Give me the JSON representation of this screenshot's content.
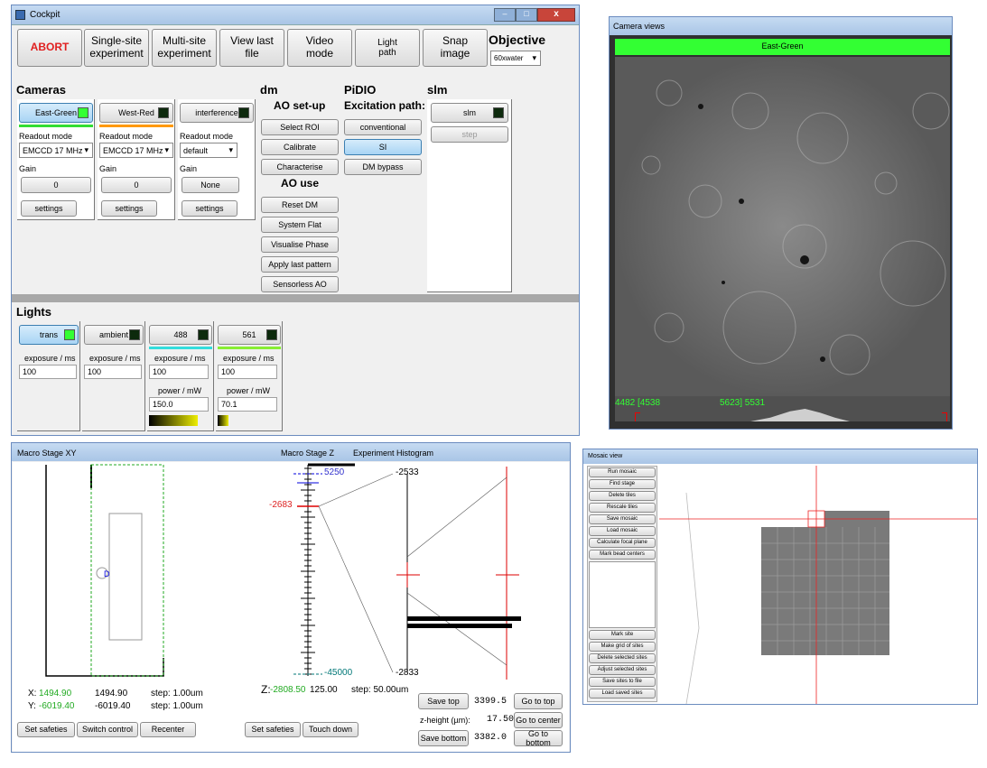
{
  "colors": {
    "accent_green": "#33ff33",
    "abort_red": "#e02020",
    "dark_chip": "#0d2a0d"
  },
  "cockpit": {
    "title": "Cockpit",
    "toolbar": {
      "abort": "ABORT",
      "single_site": "Single-site\nexperiment",
      "multi_site": "Multi-site\nexperiment",
      "view_last": "View last\nfile",
      "video": "Video\nmode",
      "light_path": "Light\npath",
      "snap": "Snap\nimage",
      "objective_label": "Objective",
      "objective_value": "60xwater"
    },
    "cameras": {
      "heading": "Cameras",
      "items": [
        {
          "name": "East-Green",
          "readout_label": "Readout mode",
          "readout": "EMCCD 17 MHz",
          "gain_label": "Gain",
          "gain": "0",
          "settings": "settings"
        },
        {
          "name": "West-Red",
          "readout_label": "Readout mode",
          "readout": "EMCCD 17 MHz",
          "gain_label": "Gain",
          "gain": "0",
          "settings": "settings"
        },
        {
          "name": "interference",
          "readout_label": "Readout mode",
          "readout": "default",
          "gain_label": "Gain",
          "gain": "None",
          "settings": "settings"
        }
      ]
    },
    "dm": {
      "heading": "dm",
      "setup_heading": "AO set-up",
      "setup_buttons": [
        "Select ROI",
        "Calibrate",
        "Characterise"
      ],
      "use_heading": "AO use",
      "use_buttons": [
        "Reset DM",
        "System Flat",
        "Visualise Phase",
        "Apply last pattern",
        "Sensorless AO"
      ]
    },
    "pidio": {
      "heading": "PiDIO",
      "sub": "Excitation path:",
      "buttons": [
        "conventional",
        "SI",
        "DM bypass"
      ]
    },
    "slm": {
      "heading": "slm",
      "button": "slm",
      "step": "step"
    },
    "lights": {
      "heading": "Lights",
      "items": [
        {
          "name": "trans",
          "exposure_label": "exposure / ms",
          "exposure": "100"
        },
        {
          "name": "ambient",
          "exposure_label": "exposure / ms",
          "exposure": "100"
        },
        {
          "name": "488",
          "exposure_label": "exposure / ms",
          "exposure": "100",
          "power_label": "power / mW",
          "power": "150.0"
        },
        {
          "name": "561",
          "exposure_label": "exposure / ms",
          "exposure": "100",
          "power_label": "power / mW",
          "power": "70.1"
        }
      ]
    }
  },
  "camera_views": {
    "title": "Camera views",
    "channel": "East-Green",
    "hist_left": "4482 [4538",
    "hist_right": "5623] 5531"
  },
  "macro": {
    "title_xy": "Macro Stage XY",
    "title_z": "Macro Stage Z",
    "title_hist": "Experiment Histogram",
    "x_label": "X:",
    "x_value": "1494.90",
    "x_value2": "1494.90",
    "x_step": "step: 1.00um",
    "y_label": "Y:",
    "y_value": "-6019.40",
    "y_value2": "-6019.40",
    "y_step": "step: 1.00um",
    "z_label": "Z:",
    "z_value": "-2808.50",
    "z_value2": "125.00",
    "z_step": "step: 50.00um",
    "z_top": "5250",
    "z_marker": "-2683",
    "z_bottom": "-45000",
    "hist_top": "-2533",
    "hist_bottom": "-2833",
    "buttons": {
      "set_safeties": "Set safeties",
      "switch_control": "Switch control",
      "recenter": "Recenter",
      "set_safeties_z": "Set safeties",
      "touch_down": "Touch down",
      "save_top": "Save top",
      "go_top": "Go to top",
      "zheight_label": "z-height (µm):",
      "go_center": "Go to center",
      "save_bottom": "Save bottom",
      "go_bottom": "Go to bottom"
    },
    "top_value": "3399.5",
    "zheight_value": "17.50",
    "bottom_value": "3382.0"
  },
  "mosaic": {
    "title": "Mosaic view",
    "buttons_top": [
      "Run mosaic",
      "Find stage",
      "Delete tiles",
      "Rescale tiles",
      "Save mosaic",
      "Load mosaic",
      "Calculate focal plane",
      "Mark bead centers"
    ],
    "buttons_bottom": [
      "Mark site",
      "Make grid of sites",
      "Delete selected sites",
      "Adjust selected sites",
      "Save sites to file",
      "Load saved sites"
    ]
  }
}
